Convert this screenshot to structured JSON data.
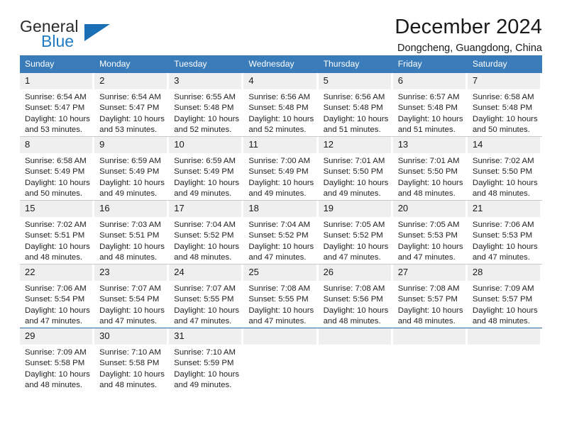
{
  "brand": {
    "name_part1": "General",
    "name_part2": "Blue",
    "accent_color": "#1b6fb4"
  },
  "header": {
    "title": "December 2024",
    "subtitle": "Dongcheng, Guangdong, China"
  },
  "theme": {
    "header_blue": "#3a7cba",
    "daynum_band": "#efefef",
    "grid_line": "#c9c9c9",
    "last_row_line": "#2a6aa8"
  },
  "calendar": {
    "weekday_headers": [
      "Sunday",
      "Monday",
      "Tuesday",
      "Wednesday",
      "Thursday",
      "Friday",
      "Saturday"
    ],
    "weeks": [
      [
        {
          "day": "1",
          "sunrise": "Sunrise: 6:54 AM",
          "sunset": "Sunset: 5:47 PM",
          "daylight_line1": "Daylight: 10 hours",
          "daylight_line2": "and 53 minutes."
        },
        {
          "day": "2",
          "sunrise": "Sunrise: 6:54 AM",
          "sunset": "Sunset: 5:47 PM",
          "daylight_line1": "Daylight: 10 hours",
          "daylight_line2": "and 53 minutes."
        },
        {
          "day": "3",
          "sunrise": "Sunrise: 6:55 AM",
          "sunset": "Sunset: 5:48 PM",
          "daylight_line1": "Daylight: 10 hours",
          "daylight_line2": "and 52 minutes."
        },
        {
          "day": "4",
          "sunrise": "Sunrise: 6:56 AM",
          "sunset": "Sunset: 5:48 PM",
          "daylight_line1": "Daylight: 10 hours",
          "daylight_line2": "and 52 minutes."
        },
        {
          "day": "5",
          "sunrise": "Sunrise: 6:56 AM",
          "sunset": "Sunset: 5:48 PM",
          "daylight_line1": "Daylight: 10 hours",
          "daylight_line2": "and 51 minutes."
        },
        {
          "day": "6",
          "sunrise": "Sunrise: 6:57 AM",
          "sunset": "Sunset: 5:48 PM",
          "daylight_line1": "Daylight: 10 hours",
          "daylight_line2": "and 51 minutes."
        },
        {
          "day": "7",
          "sunrise": "Sunrise: 6:58 AM",
          "sunset": "Sunset: 5:48 PM",
          "daylight_line1": "Daylight: 10 hours",
          "daylight_line2": "and 50 minutes."
        }
      ],
      [
        {
          "day": "8",
          "sunrise": "Sunrise: 6:58 AM",
          "sunset": "Sunset: 5:49 PM",
          "daylight_line1": "Daylight: 10 hours",
          "daylight_line2": "and 50 minutes."
        },
        {
          "day": "9",
          "sunrise": "Sunrise: 6:59 AM",
          "sunset": "Sunset: 5:49 PM",
          "daylight_line1": "Daylight: 10 hours",
          "daylight_line2": "and 49 minutes."
        },
        {
          "day": "10",
          "sunrise": "Sunrise: 6:59 AM",
          "sunset": "Sunset: 5:49 PM",
          "daylight_line1": "Daylight: 10 hours",
          "daylight_line2": "and 49 minutes."
        },
        {
          "day": "11",
          "sunrise": "Sunrise: 7:00 AM",
          "sunset": "Sunset: 5:49 PM",
          "daylight_line1": "Daylight: 10 hours",
          "daylight_line2": "and 49 minutes."
        },
        {
          "day": "12",
          "sunrise": "Sunrise: 7:01 AM",
          "sunset": "Sunset: 5:50 PM",
          "daylight_line1": "Daylight: 10 hours",
          "daylight_line2": "and 49 minutes."
        },
        {
          "day": "13",
          "sunrise": "Sunrise: 7:01 AM",
          "sunset": "Sunset: 5:50 PM",
          "daylight_line1": "Daylight: 10 hours",
          "daylight_line2": "and 48 minutes."
        },
        {
          "day": "14",
          "sunrise": "Sunrise: 7:02 AM",
          "sunset": "Sunset: 5:50 PM",
          "daylight_line1": "Daylight: 10 hours",
          "daylight_line2": "and 48 minutes."
        }
      ],
      [
        {
          "day": "15",
          "sunrise": "Sunrise: 7:02 AM",
          "sunset": "Sunset: 5:51 PM",
          "daylight_line1": "Daylight: 10 hours",
          "daylight_line2": "and 48 minutes."
        },
        {
          "day": "16",
          "sunrise": "Sunrise: 7:03 AM",
          "sunset": "Sunset: 5:51 PM",
          "daylight_line1": "Daylight: 10 hours",
          "daylight_line2": "and 48 minutes."
        },
        {
          "day": "17",
          "sunrise": "Sunrise: 7:04 AM",
          "sunset": "Sunset: 5:52 PM",
          "daylight_line1": "Daylight: 10 hours",
          "daylight_line2": "and 48 minutes."
        },
        {
          "day": "18",
          "sunrise": "Sunrise: 7:04 AM",
          "sunset": "Sunset: 5:52 PM",
          "daylight_line1": "Daylight: 10 hours",
          "daylight_line2": "and 47 minutes."
        },
        {
          "day": "19",
          "sunrise": "Sunrise: 7:05 AM",
          "sunset": "Sunset: 5:52 PM",
          "daylight_line1": "Daylight: 10 hours",
          "daylight_line2": "and 47 minutes."
        },
        {
          "day": "20",
          "sunrise": "Sunrise: 7:05 AM",
          "sunset": "Sunset: 5:53 PM",
          "daylight_line1": "Daylight: 10 hours",
          "daylight_line2": "and 47 minutes."
        },
        {
          "day": "21",
          "sunrise": "Sunrise: 7:06 AM",
          "sunset": "Sunset: 5:53 PM",
          "daylight_line1": "Daylight: 10 hours",
          "daylight_line2": "and 47 minutes."
        }
      ],
      [
        {
          "day": "22",
          "sunrise": "Sunrise: 7:06 AM",
          "sunset": "Sunset: 5:54 PM",
          "daylight_line1": "Daylight: 10 hours",
          "daylight_line2": "and 47 minutes."
        },
        {
          "day": "23",
          "sunrise": "Sunrise: 7:07 AM",
          "sunset": "Sunset: 5:54 PM",
          "daylight_line1": "Daylight: 10 hours",
          "daylight_line2": "and 47 minutes."
        },
        {
          "day": "24",
          "sunrise": "Sunrise: 7:07 AM",
          "sunset": "Sunset: 5:55 PM",
          "daylight_line1": "Daylight: 10 hours",
          "daylight_line2": "and 47 minutes."
        },
        {
          "day": "25",
          "sunrise": "Sunrise: 7:08 AM",
          "sunset": "Sunset: 5:55 PM",
          "daylight_line1": "Daylight: 10 hours",
          "daylight_line2": "and 47 minutes."
        },
        {
          "day": "26",
          "sunrise": "Sunrise: 7:08 AM",
          "sunset": "Sunset: 5:56 PM",
          "daylight_line1": "Daylight: 10 hours",
          "daylight_line2": "and 48 minutes."
        },
        {
          "day": "27",
          "sunrise": "Sunrise: 7:08 AM",
          "sunset": "Sunset: 5:57 PM",
          "daylight_line1": "Daylight: 10 hours",
          "daylight_line2": "and 48 minutes."
        },
        {
          "day": "28",
          "sunrise": "Sunrise: 7:09 AM",
          "sunset": "Sunset: 5:57 PM",
          "daylight_line1": "Daylight: 10 hours",
          "daylight_line2": "and 48 minutes."
        }
      ],
      [
        {
          "day": "29",
          "sunrise": "Sunrise: 7:09 AM",
          "sunset": "Sunset: 5:58 PM",
          "daylight_line1": "Daylight: 10 hours",
          "daylight_line2": "and 48 minutes."
        },
        {
          "day": "30",
          "sunrise": "Sunrise: 7:10 AM",
          "sunset": "Sunset: 5:58 PM",
          "daylight_line1": "Daylight: 10 hours",
          "daylight_line2": "and 48 minutes."
        },
        {
          "day": "31",
          "sunrise": "Sunrise: 7:10 AM",
          "sunset": "Sunset: 5:59 PM",
          "daylight_line1": "Daylight: 10 hours",
          "daylight_line2": "and 49 minutes."
        },
        {
          "day": "",
          "sunrise": "",
          "sunset": "",
          "daylight_line1": "",
          "daylight_line2": ""
        },
        {
          "day": "",
          "sunrise": "",
          "sunset": "",
          "daylight_line1": "",
          "daylight_line2": ""
        },
        {
          "day": "",
          "sunrise": "",
          "sunset": "",
          "daylight_line1": "",
          "daylight_line2": ""
        },
        {
          "day": "",
          "sunrise": "",
          "sunset": "",
          "daylight_line1": "",
          "daylight_line2": ""
        }
      ]
    ]
  }
}
